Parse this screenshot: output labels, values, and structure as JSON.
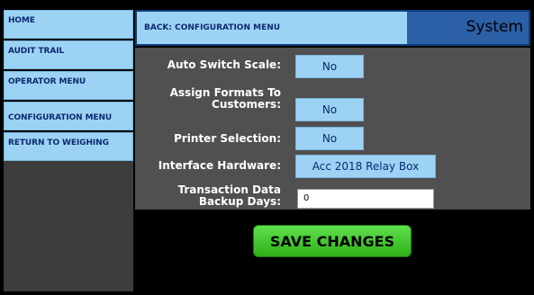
{
  "sidebar": {
    "items": [
      {
        "label": "HOME"
      },
      {
        "label": "AUDIT TRAIL"
      },
      {
        "label": "OPERATOR MENU"
      },
      {
        "label": "CONFIGURATION MENU"
      },
      {
        "label": "RETURN TO WEIGHING"
      }
    ]
  },
  "header": {
    "back_label": "BACK: CONFIGURATION MENU",
    "title": "System"
  },
  "settings": {
    "auto_switch_scale": {
      "label": "Auto Switch Scale:",
      "value": "No"
    },
    "assign_formats": {
      "label_line1": "Assign Formats To",
      "label_line2": "Customers:",
      "value": "No"
    },
    "printer_selection": {
      "label": "Printer Selection:",
      "value": "No"
    },
    "interface_hardware": {
      "label": "Interface Hardware:",
      "value": "Acc 2018 Relay Box"
    },
    "transaction_backup": {
      "label_line1": "Transaction Data",
      "label_line2": "Backup Days:",
      "value": "0"
    }
  },
  "actions": {
    "save_label": "SAVE CHANGES"
  },
  "colors": {
    "nav_bg": "#9cd3f5",
    "header_bg": "#0a3d7a",
    "title_bg": "#2b5fa6",
    "content_bg": "#505050",
    "save_green": "#3fcf2a"
  }
}
